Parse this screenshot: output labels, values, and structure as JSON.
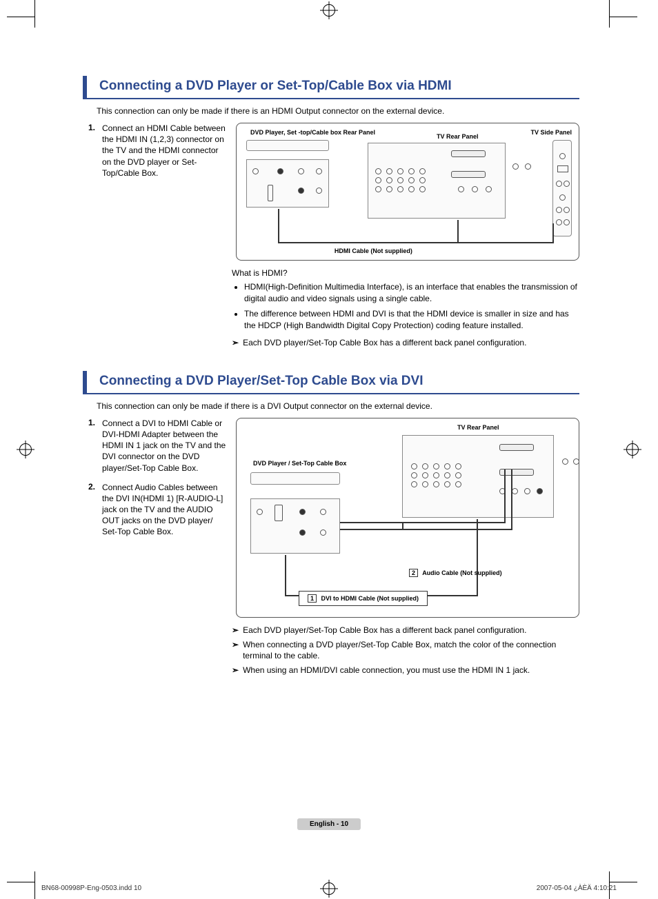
{
  "section1": {
    "title": "Connecting a DVD Player or Set-Top/Cable Box via HDMI",
    "intro": "This connection can only be made if there is an HDMI Output connector on the external device.",
    "steps": [
      {
        "num": "1.",
        "text": "Connect an HDMI Cable between the HDMI IN (1,2,3) connector on the TV and the HDMI connector on the DVD player or Set-Top/Cable Box."
      }
    ],
    "diagram": {
      "dvd_label": "DVD Player, Set -top/Cable box Rear Panel",
      "tv_rear_label": "TV Rear Panel",
      "tv_side_label": "TV Side Panel",
      "cable_label": "HDMI Cable (Not supplied)"
    },
    "notes": {
      "question": "What is HDMI?",
      "bullets": [
        "HDMI(High-Definition Multimedia Interface), is an interface that enables the transmission of digital audio and video signals using a single cable.",
        "The difference between HDMI and DVI is that the HDMI device is smaller in size and has the HDCP (High Bandwidth Digital Copy Protection) coding feature installed."
      ],
      "arrow": "Each DVD player/Set-Top Cable Box has a different back panel configuration."
    }
  },
  "section2": {
    "title": "Connecting a DVD Player/Set-Top Cable Box via DVI",
    "intro": "This connection can only be made if there is a DVI Output connector on the external device.",
    "steps": [
      {
        "num": "1.",
        "text": "Connect a DVI to HDMI Cable or DVI-HDMI Adapter between the HDMI IN 1 jack on the TV and the DVI connector on the DVD player/Set-Top Cable Box."
      },
      {
        "num": "2.",
        "text": "Connect Audio Cables between the DVI IN(HDMI 1) [R-AUDIO-L] jack on the TV and the AUDIO OUT jacks on the DVD player/ Set-Top Cable Box."
      }
    ],
    "diagram": {
      "dvd_label": "DVD Player / Set-Top Cable Box",
      "tv_rear_label": "TV Rear Panel",
      "audio_cable_tag": "2",
      "audio_cable_label": "Audio Cable (Not supplied)",
      "dvi_cable_tag": "1",
      "dvi_cable_label": "DVI to HDMI Cable (Not supplied)"
    },
    "notes_arrows": [
      "Each DVD player/Set-Top Cable Box has a different back panel configuration.",
      "When connecting a DVD player/Set-Top Cable Box, match the color of the connection terminal to the cable.",
      "When using an HDMI/DVI cable connection, you must use the HDMI IN 1 jack."
    ]
  },
  "footer": {
    "page_label": "English - 10",
    "print_file": "BN68-00998P-Eng-0503.indd   10",
    "print_timestamp": "2007-05-04   ¿ÀÈÄ 4:10:21"
  }
}
